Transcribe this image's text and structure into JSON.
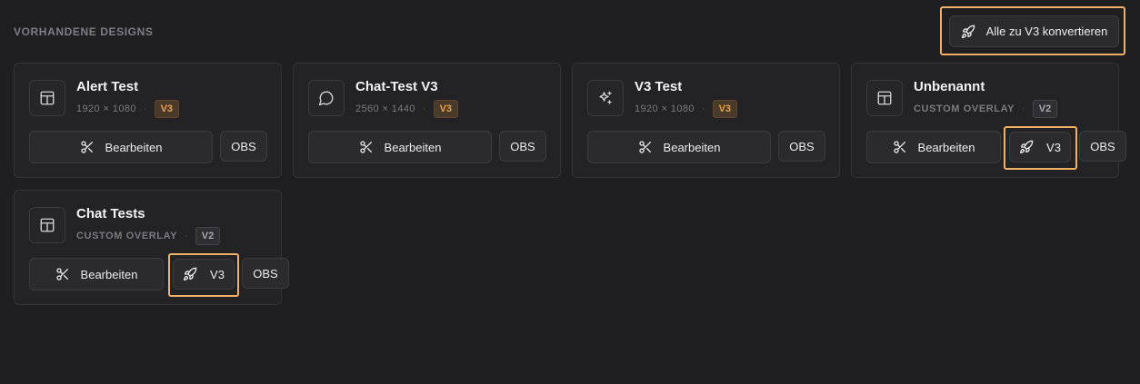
{
  "section_title": "VORHANDENE DESIGNS",
  "convert_all_label": "Alle zu V3 konvertieren",
  "colors": {
    "accent": "#f0b066",
    "v3_badge": "#e9a24c",
    "background": "#1f1f21"
  },
  "cards": [
    {
      "name": "Alert Test",
      "subtitle": "1920 × 1080",
      "version": "V3",
      "icon": "layout-icon",
      "edit_label": "Bearbeiten",
      "obs_label": "OBS"
    },
    {
      "name": "Chat-Test V3",
      "subtitle": "2560 × 1440",
      "version": "V3",
      "icon": "chat-bubble-icon",
      "edit_label": "Bearbeiten",
      "obs_label": "OBS"
    },
    {
      "name": "V3 Test",
      "subtitle": "1920 × 1080",
      "version": "V3",
      "icon": "sparkles-icon",
      "edit_label": "Bearbeiten",
      "obs_label": "OBS"
    },
    {
      "name": "Unbenannt",
      "subtitle": "CUSTOM OVERLAY",
      "version": "V2",
      "icon": "layout-icon",
      "edit_label": "Bearbeiten",
      "convert_label": "V3",
      "obs_label": "OBS"
    },
    {
      "name": "Chat Tests",
      "subtitle": "CUSTOM OVERLAY",
      "version": "V2",
      "icon": "layout-icon",
      "edit_label": "Bearbeiten",
      "convert_label": "V3",
      "obs_label": "OBS"
    }
  ]
}
